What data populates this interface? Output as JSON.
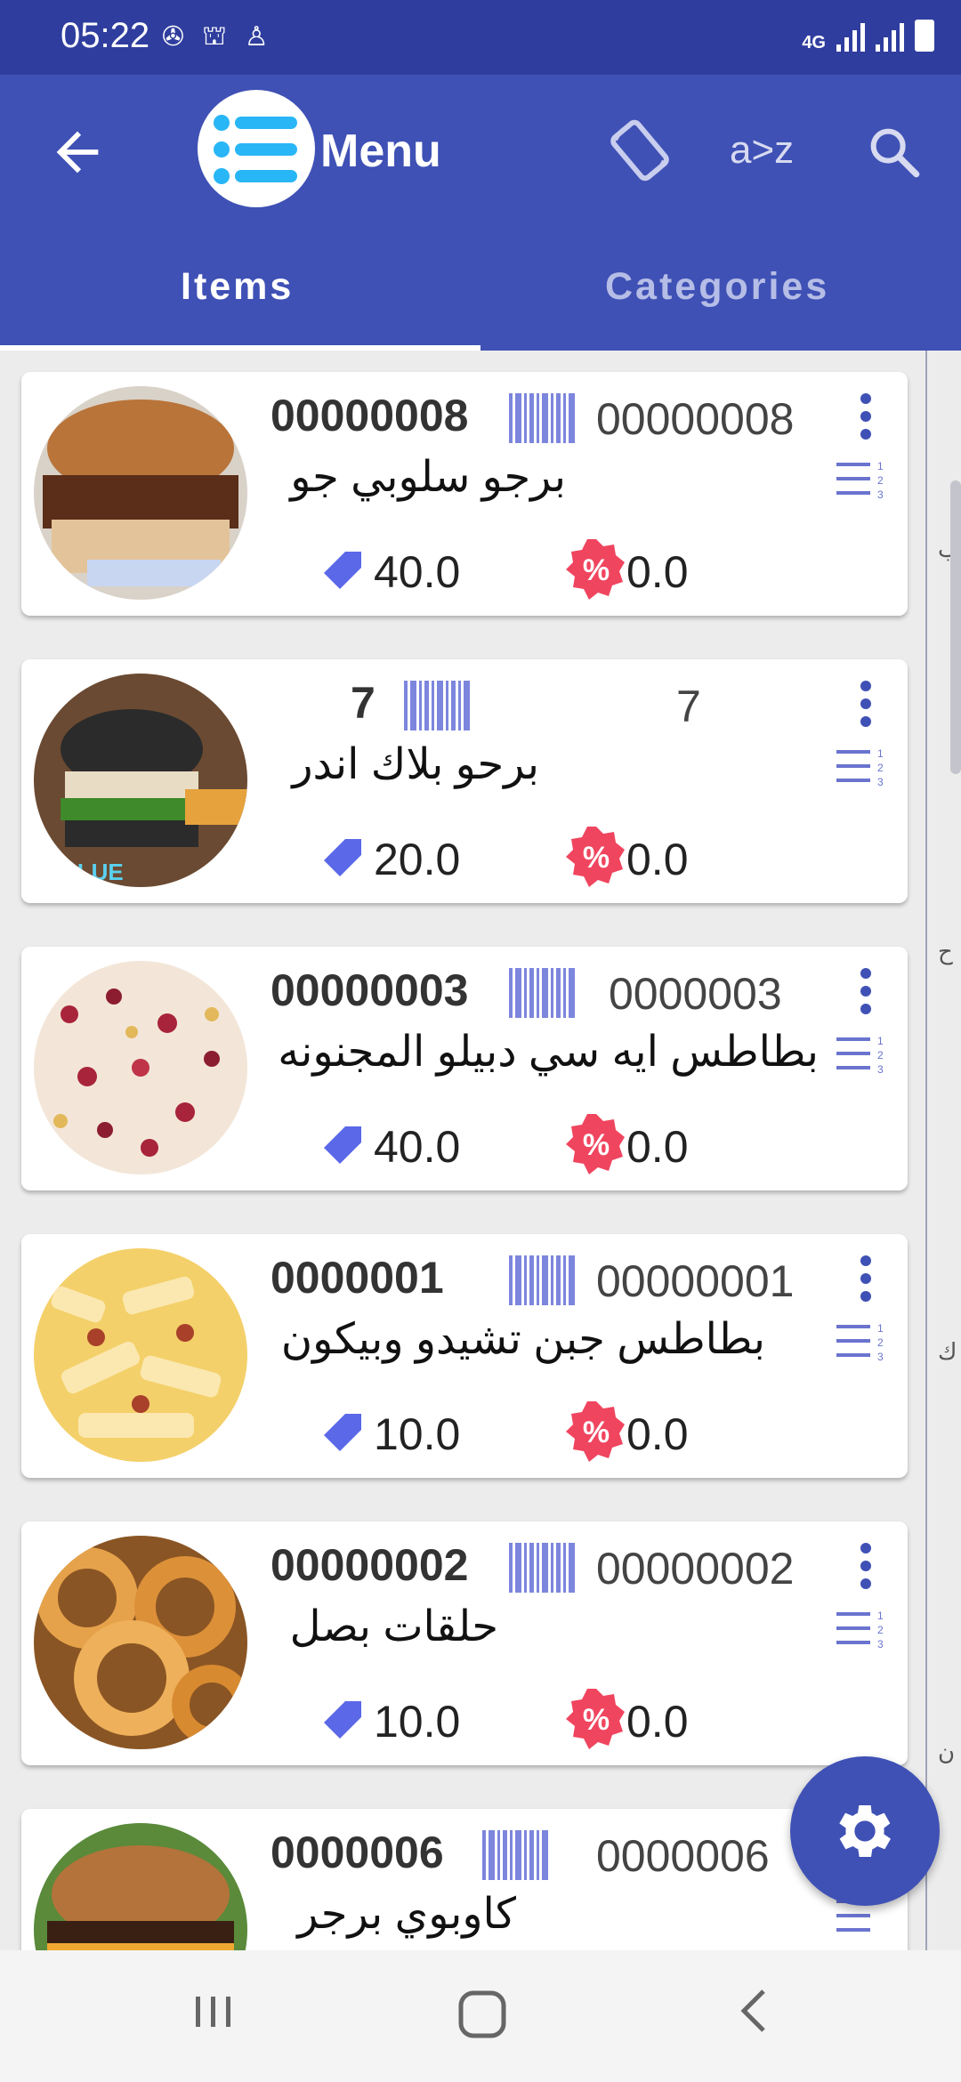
{
  "status_bar": {
    "time": "05:22",
    "network": "4G"
  },
  "app_bar": {
    "title": "Menu",
    "sort_label": "a>z",
    "icons": [
      "back-arrow-icon",
      "menu-list-logo-icon",
      "screen-rotate-icon",
      "sort-az-icon",
      "search-icon"
    ]
  },
  "tabs": [
    {
      "label": "Items",
      "selected": true
    },
    {
      "label": "Categories",
      "selected": false
    }
  ],
  "items": [
    {
      "code": "00000008",
      "barcode": "00000008",
      "name": "برجو سلوبي جو",
      "price": "40.0",
      "discount": "0.0"
    },
    {
      "code": "7",
      "barcode": "7",
      "name": "برحو بلاك اندر",
      "price": "20.0",
      "discount": "0.0"
    },
    {
      "code": "00000003",
      "barcode": "0000003",
      "name": "بطاطس ايه سي دبيلو المجنونه",
      "price": "40.0",
      "discount": "0.0"
    },
    {
      "code": "0000001",
      "barcode": "00000001",
      "name": "بطاطس جبن تشيدو وبيكون",
      "price": "10.0",
      "discount": "0.0"
    },
    {
      "code": "00000002",
      "barcode": "00000002",
      "name": "حلقات بصل",
      "price": "10.0",
      "discount": "0.0"
    },
    {
      "code": "0000006",
      "barcode": "0000006",
      "name": "كاوبوي برجر",
      "price": "",
      "discount": ""
    }
  ],
  "index_letters": [
    "ب",
    "ح",
    "ك",
    "ن"
  ],
  "colors": {
    "primary": "#3f51b5",
    "status_bar": "#2f3e9e",
    "accent_discount": "#f0455f",
    "price_tag": "#5b68e8"
  }
}
